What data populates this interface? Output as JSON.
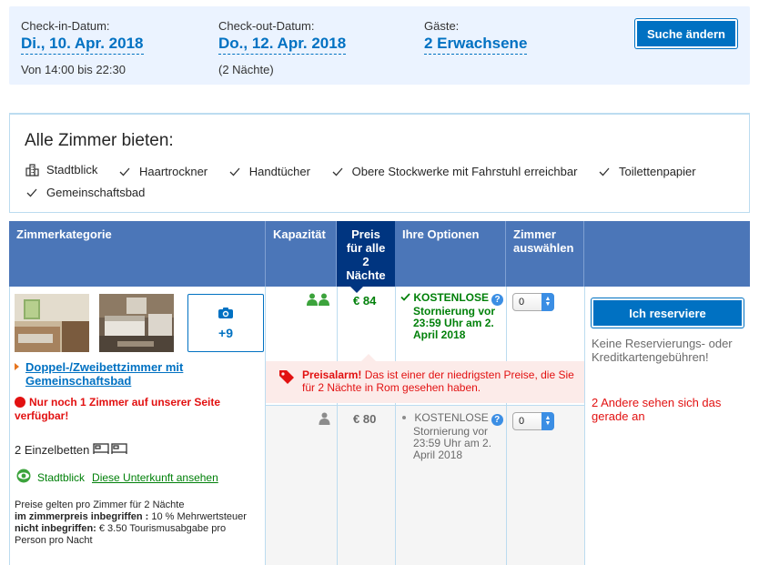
{
  "search": {
    "checkin_label": "Check-in-Datum:",
    "checkin_value": "Di., 10. Apr. 2018",
    "checkin_time": "Von 14:00 bis 22:30",
    "checkout_label": "Check-out-Datum:",
    "checkout_value": "Do., 12. Apr. 2018",
    "checkout_nights": "(2 Nächte)",
    "guests_label": "Gäste:",
    "guests_value": "2 Erwachsene",
    "change_button": "Suche ändern"
  },
  "facilities": {
    "title": "Alle Zimmer bieten:",
    "items": [
      {
        "label": "Stadtblick",
        "icon": "city-view-icon"
      },
      {
        "label": "Haartrockner",
        "icon": "check-icon"
      },
      {
        "label": "Handtücher",
        "icon": "check-icon"
      },
      {
        "label": "Obere Stockwerke mit Fahrstuhl erreichbar",
        "icon": "check-icon"
      },
      {
        "label": "Toilettenpapier",
        "icon": "check-icon"
      },
      {
        "label": "Gemeinschaftsbad",
        "icon": "check-icon"
      }
    ]
  },
  "table": {
    "headers": {
      "category": "Zimmerkategorie",
      "capacity": "Kapazität",
      "price": "Preis für alle 2 Nächte",
      "options": "Ihre Optionen",
      "select": "Zimmer auswählen"
    },
    "room": {
      "photos_more": "+9",
      "name": "Doppel-/Zweibettzimmer mit Gemeinschaftsbad",
      "urgency": "Nur noch 1 Zimmer auf unserer Seite verfügbar!",
      "beds": "2 Einzelbetten",
      "view_label": "Stadtblick",
      "view_link": "Diese Unterkunft ansehen",
      "price_info_1": "Preise gelten pro Zimmer für 2 Nächte",
      "price_info_2_bold": "im zimmerpreis inbegriffen :",
      "price_info_2": " 10 % Mehrwertsteuer",
      "price_info_3_bold": "nicht inbegriffen:",
      "price_info_3": " € 3.50 Tourismusabgabe pro Person pro Nacht"
    },
    "offers": [
      {
        "price": "€ 84",
        "option": "KOSTENLOSE Stornierung vor 23:59 Uhr am 2. April 2018",
        "option_head": "KOSTENLOSE",
        "option_rest": "Stornierung vor 23:59 Uhr am 2. April 2018",
        "select_value": "0"
      },
      {
        "price": "€ 80",
        "option_head": "KOSTENLOSE",
        "option_rest": "Stornierung vor 23:59 Uhr am 2. April 2018",
        "select_value": "0"
      }
    ],
    "reserve_button": "Ich reserviere",
    "no_fees": "Keine Reservierungs- oder Kreditkartengebühren!",
    "others_viewing": "2 Andere sehen sich das gerade an",
    "alarm_strong": "Preisalarm!",
    "alarm_text": " Das ist einer der niedrigsten Preise, die Sie für 2 Nächte in Rom gesehen haben."
  },
  "colors": {
    "brand_blue": "#0071c2",
    "header_blue": "#4b76b8",
    "dark_blue": "#003580",
    "green": "#008009",
    "red": "#e21111"
  }
}
